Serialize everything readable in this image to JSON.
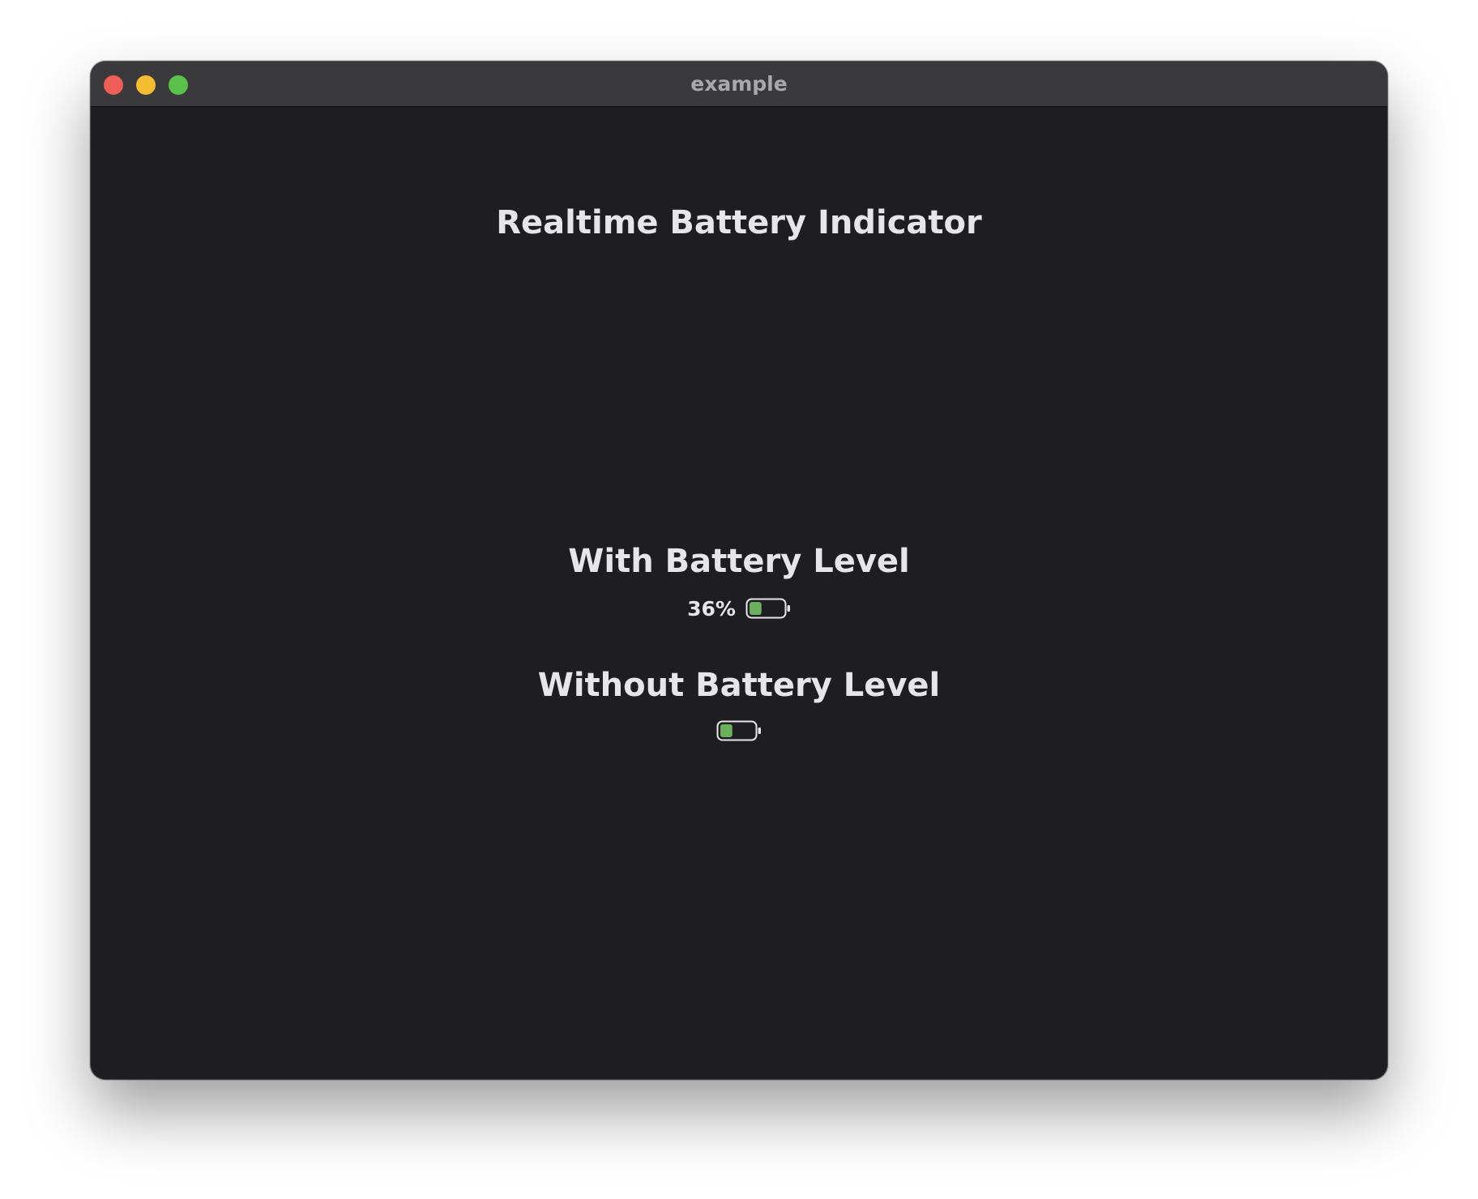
{
  "window": {
    "title": "example"
  },
  "app": {
    "title": "Realtime Battery Indicator"
  },
  "sections": {
    "with_level": {
      "heading": "With Battery Level",
      "level_text": "36%",
      "level_fraction": 0.36
    },
    "without_level": {
      "heading": "Without Battery Level",
      "level_fraction": 0.36
    }
  },
  "colors": {
    "battery_fill": "#6bb05c",
    "battery_outline": "#e6e5e8",
    "window_background": "#1e1d21",
    "titlebar_background": "#3a393c"
  }
}
